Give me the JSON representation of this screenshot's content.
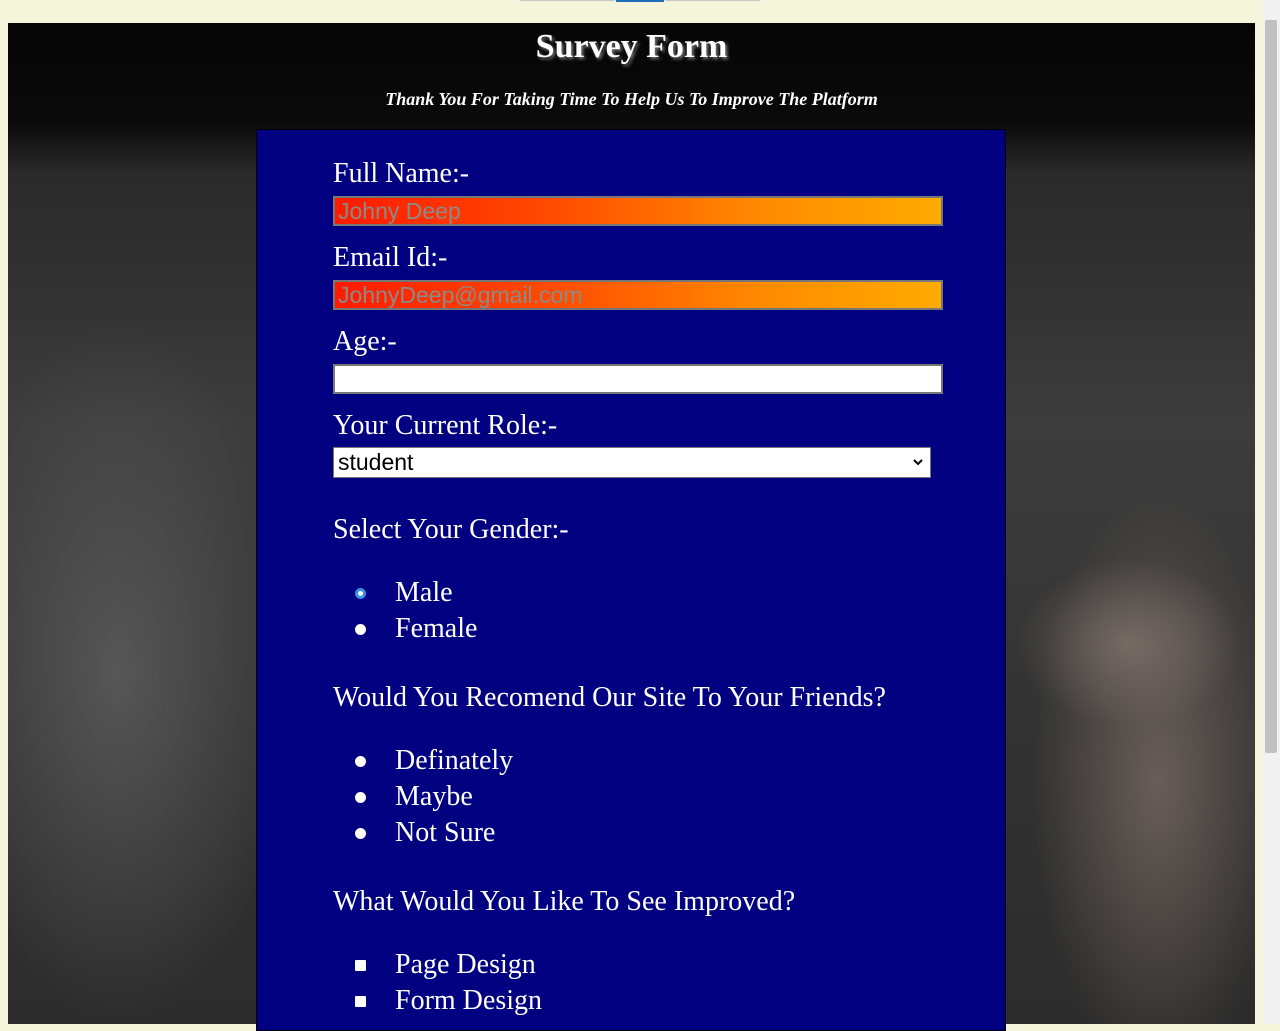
{
  "page": {
    "title": "Survey Form",
    "subtitle": "Thank You For Taking Time To Help Us To Improve The Platform"
  },
  "form": {
    "full_name": {
      "label": "Full Name:-",
      "placeholder": "Johny Deep",
      "value": ""
    },
    "email": {
      "label": "Email Id:-",
      "placeholder": "JohnyDeep@gmail.com",
      "value": ""
    },
    "age": {
      "label": "Age:-",
      "placeholder": "",
      "value": ""
    },
    "role": {
      "label": "Your Current Role:-",
      "selected": "student"
    },
    "gender": {
      "label": "Select Your Gender:-",
      "options": [
        {
          "label": "Male",
          "checked": true
        },
        {
          "label": "Female",
          "checked": false
        }
      ]
    },
    "recommend": {
      "label": "Would You Recomend Our Site To Your Friends?",
      "options": [
        {
          "label": "Definately",
          "checked": false
        },
        {
          "label": "Maybe",
          "checked": false
        },
        {
          "label": "Not Sure",
          "checked": false
        }
      ]
    },
    "improve": {
      "label": "What Would You Like To See Improved?",
      "options": [
        {
          "label": "Page Design",
          "checked": false
        },
        {
          "label": "Form Design",
          "checked": false
        }
      ]
    }
  },
  "colors": {
    "panel": "#000080",
    "input_gradient_start": "#ff1a00",
    "input_gradient_end": "#ffab00",
    "radio_checked": "#3d8fe0"
  },
  "icons": {
    "select_arrow": "chevron-down-icon"
  }
}
